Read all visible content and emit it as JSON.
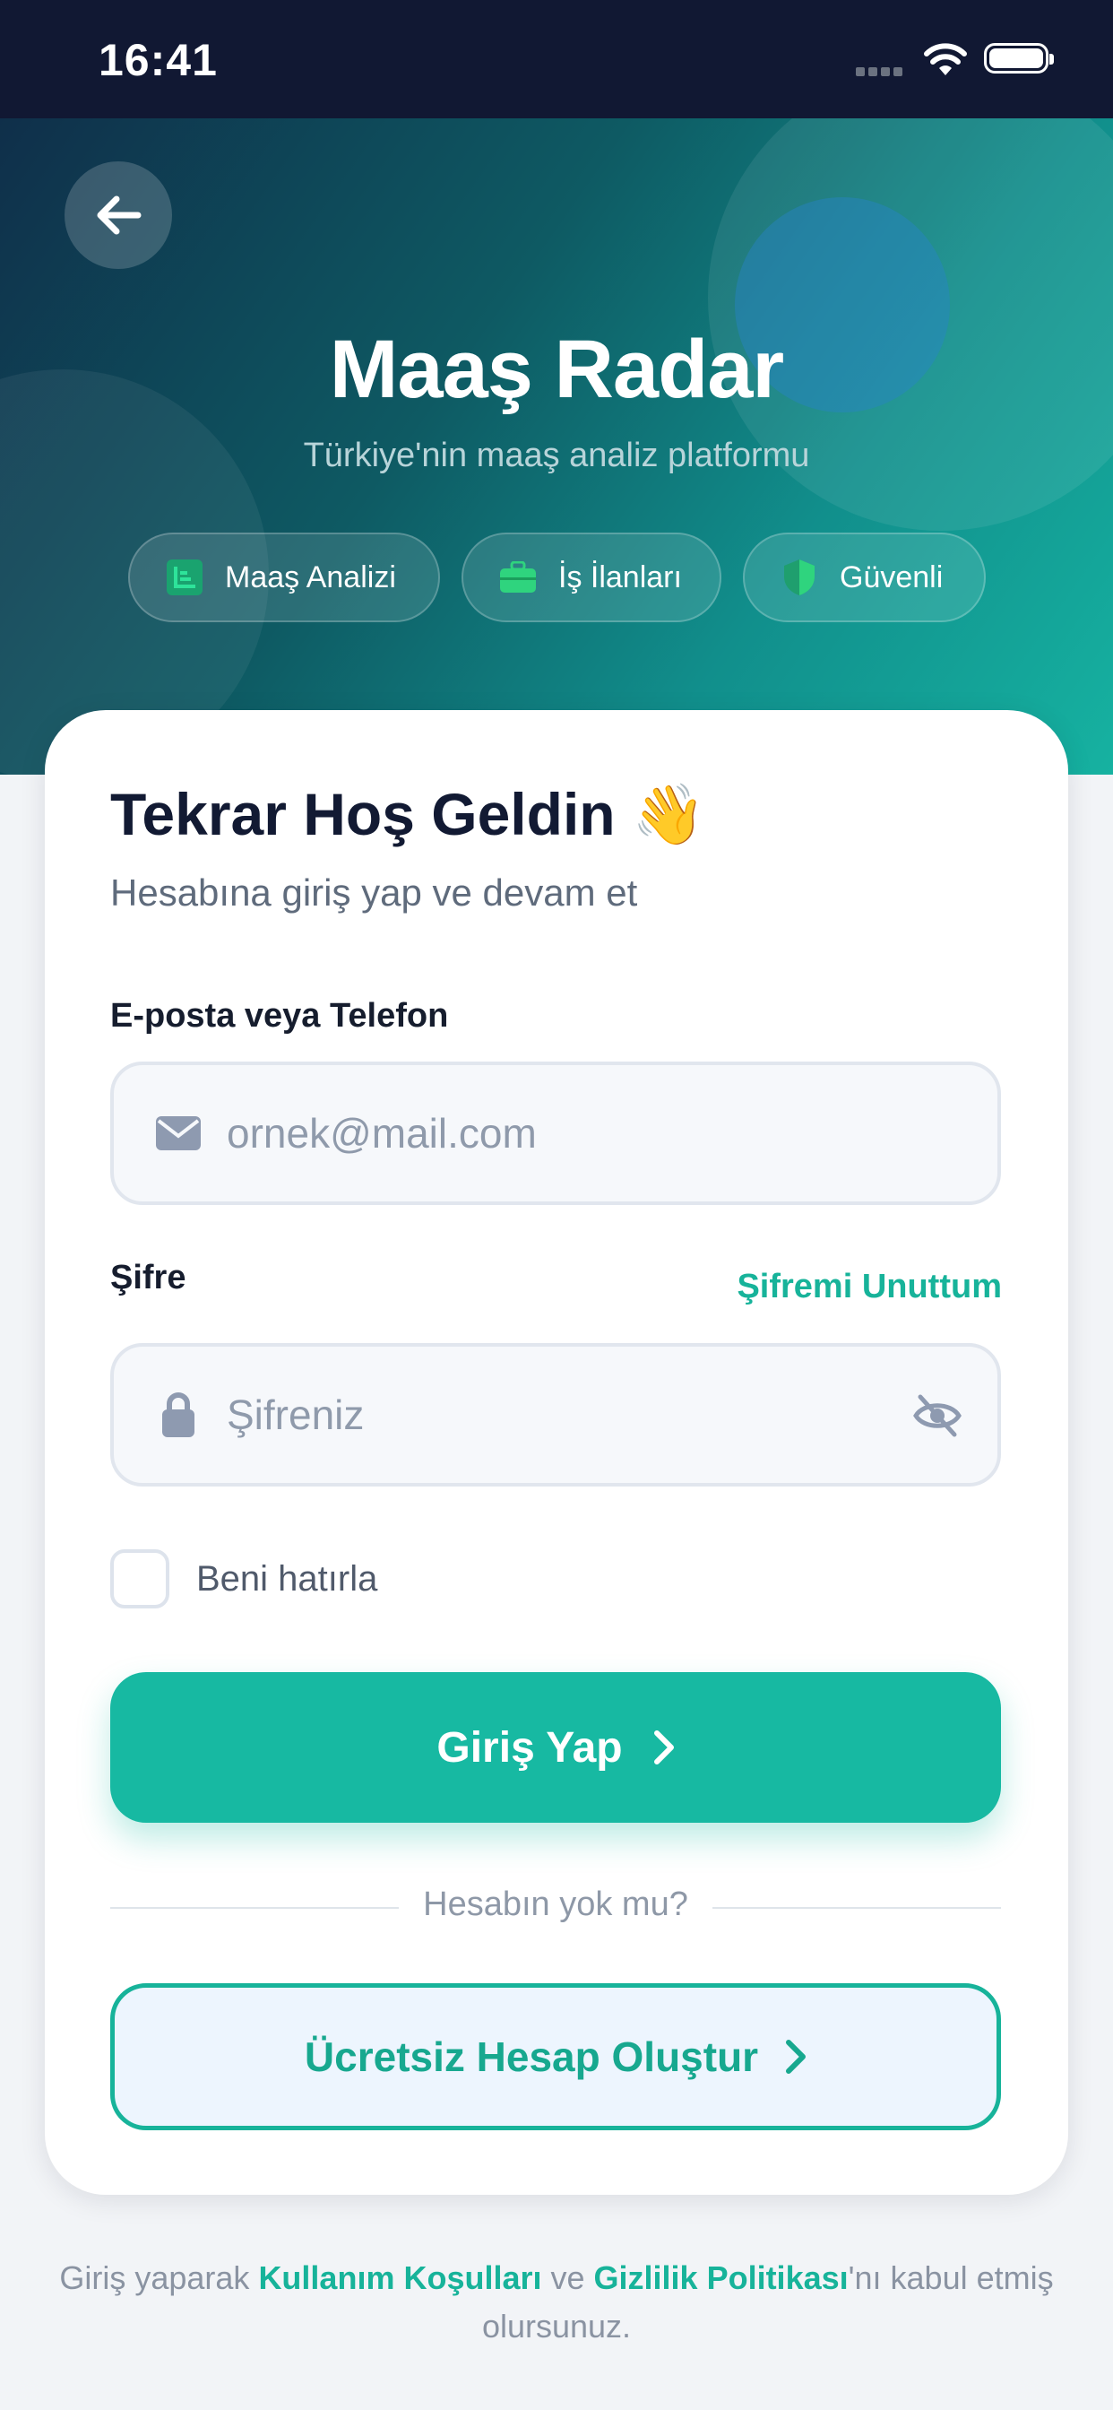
{
  "status_bar": {
    "time": "16:41"
  },
  "hero": {
    "title": "Maaş Radar",
    "subtitle": "Türkiye'nin maaş analiz platformu",
    "chips": [
      {
        "label": "Maaş Analizi",
        "icon": "chart-icon"
      },
      {
        "label": "İş İlanları",
        "icon": "briefcase-icon"
      },
      {
        "label": "Güvenli",
        "icon": "shield-icon"
      }
    ]
  },
  "login": {
    "heading": "Tekrar Hoş Geldin 👋",
    "subheading": "Hesabına giriş yap ve devam et",
    "email_label": "E-posta veya Telefon",
    "email_placeholder": "ornek@mail.com",
    "password_label": "Şifre",
    "forgot_link": "Şifremi Unuttum",
    "password_placeholder": "Şifreniz",
    "remember_label": "Beni hatırla",
    "remember_checked": false,
    "submit_label": "Giriş Yap",
    "divider_text": "Hesabın yok mu?",
    "register_label": "Ücretsiz Hesap Oluştur"
  },
  "terms": {
    "prefix": "Giriş yaparak ",
    "terms_link": "Kullanım Koşulları",
    "middle": " ve ",
    "privacy_link": "Gizlilik Politikası",
    "suffix": "'nı kabul etmiş olursunuz."
  },
  "colors": {
    "accent": "#17b9a2",
    "status_bar": "#111833",
    "hero_start": "#0f2f4a",
    "hero_end": "#16b2a1"
  }
}
